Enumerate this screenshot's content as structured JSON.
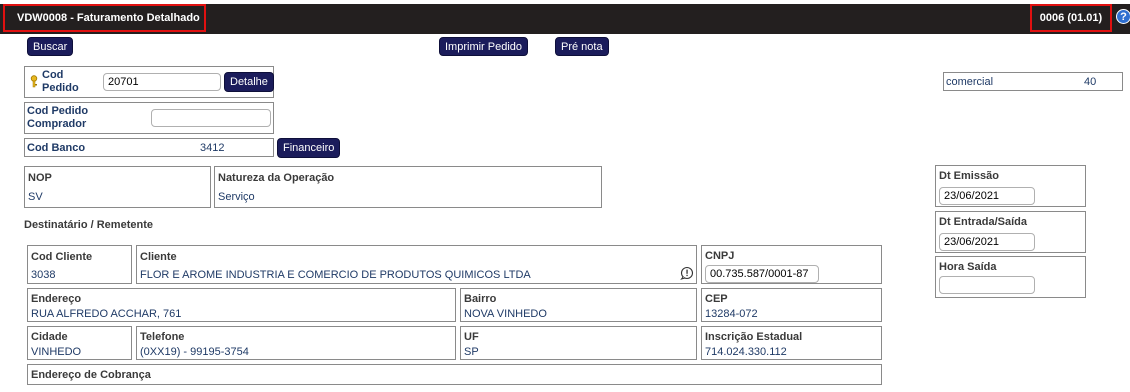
{
  "header": {
    "title": "VDW0008 - Faturamento Detalhado",
    "version": "0006 (01.01)",
    "help": "?"
  },
  "toolbar": {
    "buscar": "Buscar",
    "imprimir": "Imprimir Pedido",
    "pre_nota": "Pré nota"
  },
  "pedido": {
    "cod_pedido_label": "Cod\nPedido",
    "cod_pedido_label_1": "Cod",
    "cod_pedido_label_2": "Pedido",
    "cod_pedido_value": "20701",
    "detalhe": "Detalhe",
    "comprador_label_1": "Cod Pedido",
    "comprador_label_2": "Comprador",
    "comprador_value": "",
    "banco_label": "Cod Banco",
    "banco_value": "3412",
    "financeiro": "Financeiro"
  },
  "comercial": {
    "label": "comercial",
    "value": "40"
  },
  "nop": {
    "label": "NOP",
    "value": "SV"
  },
  "natureza": {
    "label": "Natureza da Operação",
    "value": "Serviço"
  },
  "datas": {
    "emissao_label": "Dt Emissão",
    "emissao_value": "23/06/2021",
    "entrada_label": "Dt Entrada/Saída",
    "entrada_value": "23/06/2021",
    "hora_label": "Hora Saída",
    "hora_value": ""
  },
  "destinatario_title": "Destinatário / Remetente",
  "cliente": {
    "cod_label": "Cod Cliente",
    "cod_value": "3038",
    "nome_label": "Cliente",
    "nome_value": "FLOR E AROME INDUSTRIA E COMERCIO DE PRODUTOS QUIMICOS LTDA",
    "cnpj_label": "CNPJ",
    "cnpj_value": "00.735.587/0001-87",
    "endereco_label": "Endereço",
    "endereco_value": "RUA ALFREDO ACCHAR, 761",
    "bairro_label": "Bairro",
    "bairro_value": "NOVA VINHEDO",
    "cep_label": "CEP",
    "cep_value": "13284-072",
    "cidade_label": "Cidade",
    "cidade_value": "VINHEDO",
    "telefone_label": "Telefone",
    "telefone_value": "(0XX19) - 99195-3754",
    "uf_label": "UF",
    "uf_value": "SP",
    "ie_label": "Inscrição Estadual",
    "ie_value": "714.024.330.112",
    "cobranca_label": "Endereço de Cobrança"
  }
}
